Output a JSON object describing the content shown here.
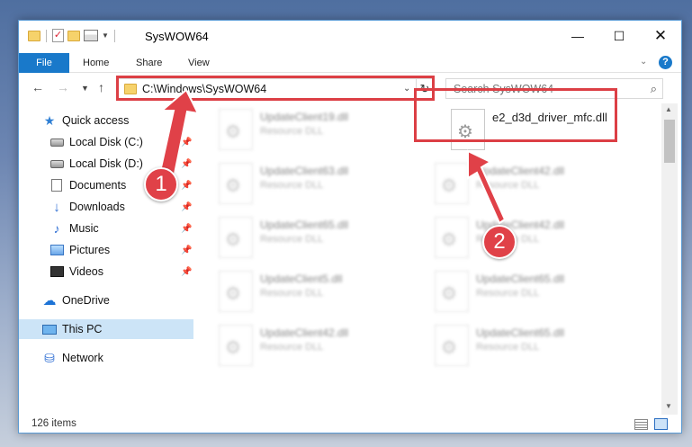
{
  "window": {
    "title": "SysWOW64",
    "controls": {
      "minimize": "—",
      "maximize": "☐",
      "close": "✕"
    }
  },
  "ribbon": {
    "tabs": [
      "File",
      "Home",
      "Share",
      "View"
    ]
  },
  "navigation": {
    "address": "C:\\Windows\\SysWOW64",
    "search_placeholder": "Search SysWOW64"
  },
  "sidebar": {
    "items": [
      {
        "label": "Quick access",
        "icon": "star-icon"
      },
      {
        "label": "Local Disk (C:)",
        "icon": "disk-icon",
        "pinned": true
      },
      {
        "label": "Local Disk (D:)",
        "icon": "disk-icon",
        "pinned": true
      },
      {
        "label": "Documents",
        "icon": "documents-icon",
        "pinned": true
      },
      {
        "label": "Downloads",
        "icon": "downloads-icon",
        "pinned": true
      },
      {
        "label": "Music",
        "icon": "music-icon",
        "pinned": true
      },
      {
        "label": "Pictures",
        "icon": "pictures-icon",
        "pinned": true
      },
      {
        "label": "Videos",
        "icon": "videos-icon",
        "pinned": true
      },
      {
        "label": "OneDrive",
        "icon": "cloud-icon"
      },
      {
        "label": "This PC",
        "icon": "pc-icon",
        "selected": true
      },
      {
        "label": "Network",
        "icon": "network-icon"
      }
    ]
  },
  "files": {
    "target": {
      "name": "e2_d3d_driver_mfc.dll"
    },
    "items": [
      {
        "name": "UpdateClient19.dll",
        "type": "Resource DLL"
      },
      {
        "name": "UpdateClient63.dll",
        "type": "Resource DLL"
      },
      {
        "name": "UpdateClient42.dll",
        "type": "Resource DLL"
      },
      {
        "name": "UpdateClient65.dll",
        "type": "Resource DLL"
      },
      {
        "name": "UpdateClient42.dll",
        "type": "Resource DLL"
      },
      {
        "name": "UpdateClient5.dll",
        "type": "Resource DLL"
      },
      {
        "name": "UpdateClient65.dll",
        "type": "Resource DLL"
      },
      {
        "name": "UpdateClient42.dll",
        "type": "Resource DLL"
      },
      {
        "name": "UpdateClient65.dll",
        "type": "Resource DLL"
      }
    ]
  },
  "status": {
    "count": "126 items"
  },
  "annotations": {
    "step1": "1",
    "step2": "2",
    "color": "#dc3f45"
  }
}
